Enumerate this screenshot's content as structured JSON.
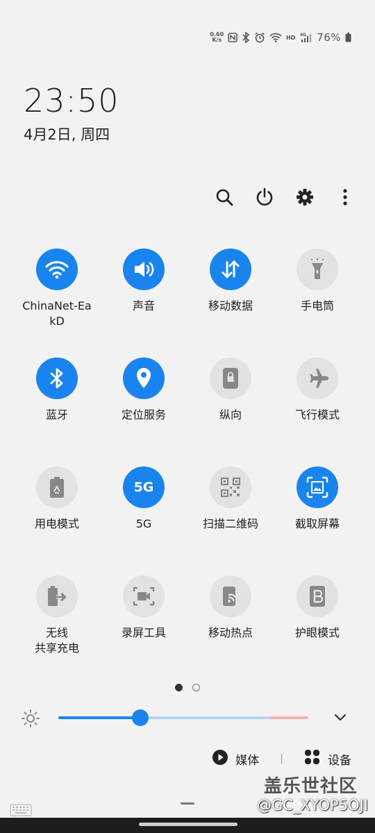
{
  "status_bar": {
    "net_speed_value": "0.60",
    "net_speed_unit": "K/s",
    "battery_percent": "76%",
    "icons": [
      "nfc-icon",
      "bluetooth-icon",
      "alarm-icon",
      "wifi-icon",
      "hd-icon",
      "4g-signal-icon",
      "battery-icon"
    ]
  },
  "clock": {
    "time": "23:50",
    "date": "4月2日, 周四"
  },
  "top_actions": [
    "search-icon",
    "power-icon",
    "settings-icon",
    "more-icon"
  ],
  "tiles": [
    {
      "label": "ChinaNet-Ea\nkD",
      "icon": "wifi-icon",
      "active": true
    },
    {
      "label": "声音",
      "icon": "sound-icon",
      "active": true
    },
    {
      "label": "移动数据",
      "icon": "mobile-data-icon",
      "active": true
    },
    {
      "label": "手电筒",
      "icon": "flashlight-icon",
      "active": false
    },
    {
      "label": "蓝牙",
      "icon": "bluetooth-icon",
      "active": true
    },
    {
      "label": "定位服务",
      "icon": "location-icon",
      "active": true
    },
    {
      "label": "纵向",
      "icon": "portrait-lock-icon",
      "active": false
    },
    {
      "label": "飞行模式",
      "icon": "airplane-icon",
      "active": false
    },
    {
      "label": "用电模式",
      "icon": "power-mode-icon",
      "active": false
    },
    {
      "label": "5G",
      "icon": "5g-icon",
      "icon_text": "5G",
      "active": true
    },
    {
      "label": "扫描二维码",
      "icon": "qr-scan-icon",
      "active": false
    },
    {
      "label": "截取屏幕",
      "icon": "screenshot-icon",
      "active": true
    },
    {
      "label": "无线\n共享充电",
      "icon": "wireless-powershare-icon",
      "active": false
    },
    {
      "label": "录屏工具",
      "icon": "screen-recorder-icon",
      "active": false
    },
    {
      "label": "移动热点",
      "icon": "hotspot-icon",
      "active": false
    },
    {
      "label": "护眼模式",
      "icon": "eye-comfort-icon",
      "active": false
    }
  ],
  "pager": {
    "pages": 2,
    "current": 1
  },
  "brightness": {
    "level": 0.33
  },
  "media_row": {
    "media_label": "媒体",
    "devices_label": "设备",
    "separator": "|"
  },
  "watermark": {
    "line1": "盖乐世社区",
    "line2": "@GC_XYOP5OJI"
  },
  "colors": {
    "accent": "#1a84ee",
    "tile_off": "#e2e2e2",
    "background": "#f2f2f2"
  }
}
